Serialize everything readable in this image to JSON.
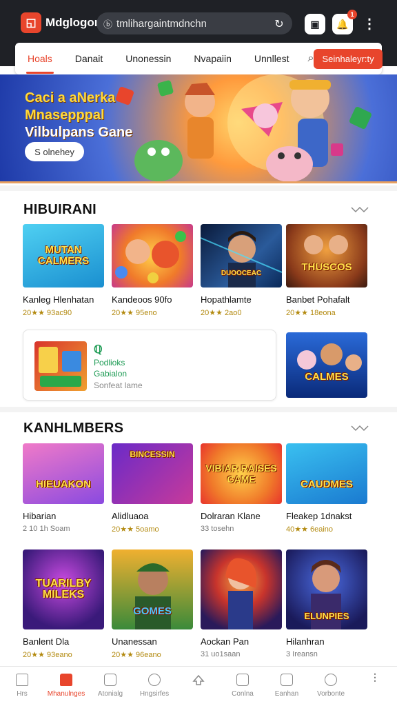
{
  "browser": {
    "app_name": "Mdglogor",
    "url": "tmlihargaintmdnchn",
    "notif_badge": "1"
  },
  "nav": {
    "tabs": [
      {
        "label": "Hoals"
      },
      {
        "label": "Danait"
      },
      {
        "label": "Unonessin"
      },
      {
        "label": "Nvapaiin"
      },
      {
        "label": "Unnllest"
      }
    ],
    "cta": "Seinhaleyr:ty"
  },
  "hero": {
    "title_line1": "Caci a aNerka",
    "title_line2": "Mnasepppal",
    "title_line3": "Vilbulpans Gane",
    "button": "S olnehey"
  },
  "section1": {
    "title": "HIBUIRANI",
    "cards": [
      {
        "thumb_text": "MUTAN CALMERS",
        "name": "Kanleg Hlenhatan",
        "meta": "20★★ 93ac90"
      },
      {
        "thumb_text": "",
        "name": "Kandeoos 90fo",
        "meta": "20★★ 95eno"
      },
      {
        "thumb_text": "DUOOCEAC",
        "name": "Hopathlamte",
        "meta": "20★★ 2ao0"
      },
      {
        "thumb_text": "THUSCOS",
        "name": "Banbet Pohafalt",
        "meta": "20★★ 18eona"
      }
    ],
    "promo": {
      "line1": "Podlioks",
      "line2": "Gabialon",
      "line3": "Sonfeat lame"
    },
    "promo_side_card": {
      "thumb_text": "CALMES"
    }
  },
  "section2": {
    "title": "KANHLMBERS",
    "row1": [
      {
        "thumb_text": "HIEUAKON",
        "name": "Hibarian",
        "meta": "2 10 1h Soam",
        "meta_grey": true
      },
      {
        "thumb_text": "BINCESSIN",
        "name": "Alidluaoa",
        "meta": "20★★ 5oamo",
        "meta_grey": false
      },
      {
        "thumb_text": "VIBIAR RAISES CAME",
        "name": "Dolraran Klane",
        "meta": "33 tosehn",
        "meta_grey": true
      },
      {
        "thumb_text": "CAUDMES",
        "name": "Fleakep 1dnakst",
        "meta": "40★★ 6eaino",
        "meta_grey": false
      }
    ],
    "row2": [
      {
        "thumb_text": "TUARILBY MILEKS",
        "name": "Banlent Dla",
        "meta": "20★★ 93eano",
        "meta_grey": false
      },
      {
        "thumb_text": "GOMES",
        "name": "Unanessan",
        "meta": "20★★ 96eano",
        "meta_grey": false
      },
      {
        "thumb_text": "",
        "name": "Aockan Pan",
        "meta": "31 uo1saan",
        "meta_grey": true
      },
      {
        "thumb_text": "ELUNPIES",
        "name": "Hilanhran",
        "meta": "3 Ireansn",
        "meta_grey": true
      }
    ]
  },
  "bottom_nav": [
    {
      "label": "Hrs",
      "icon": "home-icon"
    },
    {
      "label": "Mhanulnges",
      "icon": "home-filled-icon",
      "active": true
    },
    {
      "label": "Atonialg",
      "icon": "square-icon"
    },
    {
      "label": "Hngsirfes",
      "icon": "smiley-icon"
    },
    {
      "label": "",
      "icon": "cloud-upload-icon"
    },
    {
      "label": "Conlna",
      "icon": "pencil-icon"
    },
    {
      "label": "Eanhan",
      "icon": "document-icon"
    },
    {
      "label": "Vorbonte",
      "icon": "search-icon"
    },
    {
      "label": "",
      "icon": "more-vertical-icon"
    }
  ],
  "colors": {
    "accent": "#e8452c",
    "topbar": "#1f2126",
    "rating": "#b38a10",
    "promo_green": "#1b9a52"
  }
}
